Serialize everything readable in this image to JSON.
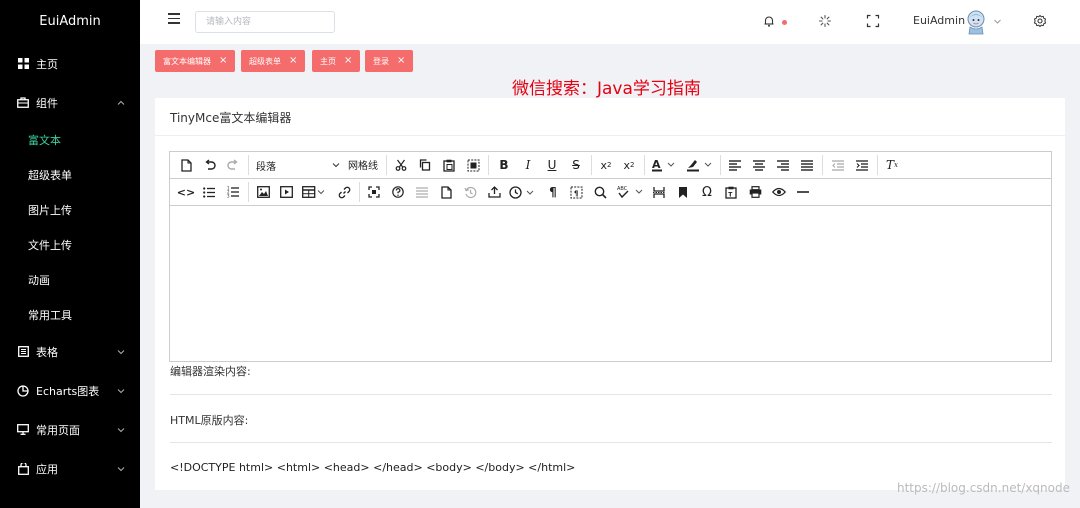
{
  "sidebar": {
    "logo": "EuiAdmin",
    "items": [
      {
        "label": "主页",
        "icon": "grid-icon"
      },
      {
        "label": "组件",
        "icon": "briefcase-icon",
        "expanded": true,
        "children": [
          "富文本",
          "超级表单",
          "图片上传",
          "文件上传",
          "动画",
          "常用工具"
        ],
        "active_child": "富文本"
      },
      {
        "label": "表格",
        "icon": "table-icon"
      },
      {
        "label": "Echarts图表",
        "icon": "pie-chart-icon"
      },
      {
        "label": "常用页面",
        "icon": "monitor-icon"
      },
      {
        "label": "应用",
        "icon": "bag-icon"
      }
    ],
    "active_color": "#3ad29f"
  },
  "header": {
    "search_placeholder": "请输入内容",
    "user_name": "EuiAdmin",
    "icons": [
      "menu-icon",
      "bell-icon",
      "loading-icon",
      "fullscreen-icon",
      "avatar",
      "settings-icon"
    ],
    "notification_dot_color": "#f56c6c"
  },
  "tags": [
    {
      "label": "富文本编辑器"
    },
    {
      "label": "超级表单"
    },
    {
      "label": "主页"
    },
    {
      "label": "登录"
    }
  ],
  "tag_color": "#f46c6c",
  "overlay_title": "微信搜索：Java学习指南",
  "card": {
    "title": "TinyMce富文本编辑器",
    "editor": {
      "block_format": "段落",
      "grid_label": "网格线"
    },
    "rendered_label": "编辑器渲染内容:",
    "html_label": "HTML原版内容:",
    "html_output": "<!DOCTYPE html> <html> <head> </head> <body> </body> </html>"
  },
  "credit": "https://blog.csdn.net/xqnode"
}
